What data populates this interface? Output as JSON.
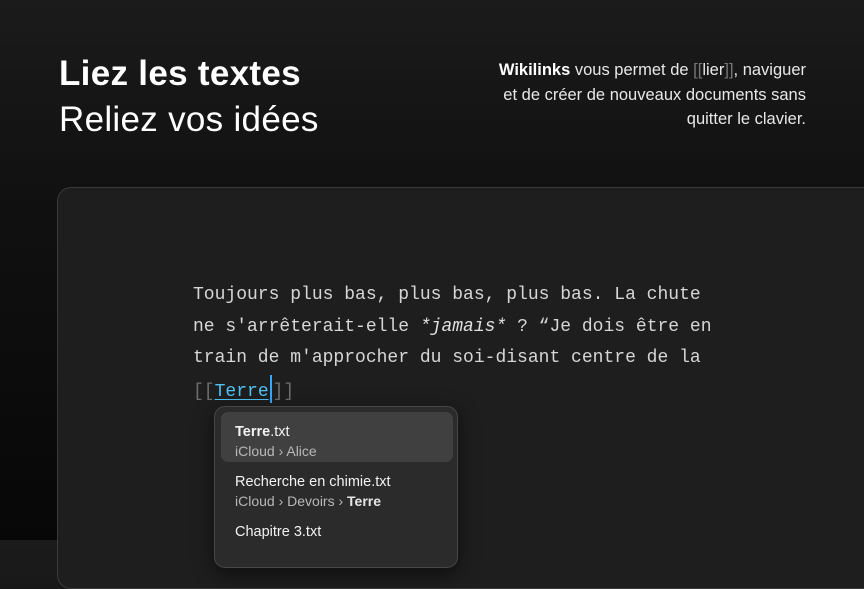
{
  "headline": {
    "line1": "Liez les textes",
    "line2": "Reliez vos idées"
  },
  "description": {
    "feature": "Wikilinks",
    "text_before": " vous permet de ",
    "bracket_open": "[[",
    "link_word": "lier",
    "bracket_close": "]]",
    "text_after": ", naviguer et de créer de nouveaux documents sans quitter le clavier."
  },
  "editor": {
    "line1": "Toujours plus bas, plus bas, plus bas. La chute",
    "line2_a": "ne s'arrêterait-elle ",
    "line2_em": "*jamais*",
    "line2_b": " ? “Je dois être en",
    "line3": "train de m'approcher du soi-disant centre de la",
    "link_open": "[[",
    "link_text": "Terre",
    "link_close": "]]"
  },
  "autocomplete": {
    "items": [
      {
        "name_bold": "Terre",
        "name_rest": ".txt",
        "path": "iCloud › Alice",
        "path_bold": "",
        "selected": true
      },
      {
        "name_bold": "",
        "name_rest": "Recherche en chimie.txt",
        "path": "iCloud › Devoirs › ",
        "path_bold": "Terre",
        "selected": false
      },
      {
        "name_bold": "",
        "name_rest": "Chapitre 3.txt",
        "path": "",
        "path_bold": "",
        "selected": false
      }
    ]
  },
  "colors": {
    "link": "#4fc3f7",
    "caret": "#39a7ff",
    "window_bg": "#1e1e1e"
  }
}
